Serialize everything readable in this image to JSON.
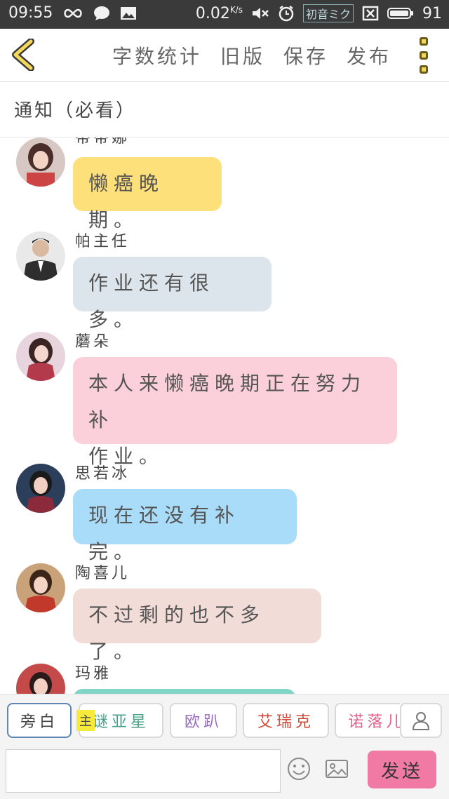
{
  "status_bar": {
    "time": "09:55",
    "net_speed": "0.02",
    "net_speed_unit": "K/s",
    "battery": "91",
    "sticker_text": "初音ミク"
  },
  "toolbar": {
    "word_count": "字数统计",
    "old_version": "旧版",
    "save": "保存",
    "publish": "发布"
  },
  "notice": {
    "title": "通知（必看）"
  },
  "messages": [
    {
      "name": "蒂蒂娜",
      "text": "懒癌晚期。",
      "bubble_color": "#fde07a",
      "avatar_color": "#b8a3a0"
    },
    {
      "name": "帕主任",
      "text": "作业还有很多。",
      "bubble_color": "#dde5ec",
      "avatar_color": "#6b6b6b"
    },
    {
      "name": "蘑朵",
      "text_line1": "本人来懒癌晚期正在努力补",
      "text_line2": "作业。",
      "bubble_color": "#fcd0da",
      "avatar_color": "#d9b7c4"
    },
    {
      "name": "思若冰",
      "text": "现在还没有补完。",
      "bubble_color": "#a9dcf8",
      "avatar_color": "#4a6a8a"
    },
    {
      "name": "陶喜儿",
      "text": "不过剩的也不多了。",
      "bubble_color": "#f2dcd8",
      "avatar_color": "#a06050"
    },
    {
      "name": "玛雅",
      "bubble_color": "#7fd6c7",
      "avatar_color": "#c44a4a"
    }
  ],
  "roles": [
    {
      "label": "旁白",
      "color": "#444444"
    },
    {
      "label": "谜亚星",
      "color": "#49a08a"
    },
    {
      "label": "欧趴",
      "color": "#9a6ac0"
    },
    {
      "label": "艾瑞克",
      "color": "#d04a3a"
    },
    {
      "label": "诺落儿",
      "color": "#e0608a"
    }
  ],
  "main_badge": "主",
  "send_label": "发送",
  "colors": {
    "accent_send": "#f07aa3",
    "status_bar": "#3a3a3a",
    "back_arrow": "#f3d85a"
  }
}
